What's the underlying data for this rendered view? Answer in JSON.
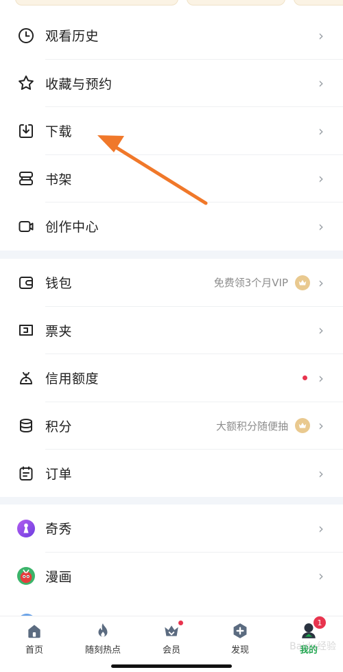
{
  "colors": {
    "accent_green": "#1aa34a",
    "arrow_orange": "#f0782a",
    "badge_red": "#e8344e",
    "crown_gold": "#e9c98f",
    "chevron_gray": "#9aa0a6"
  },
  "section1": {
    "items": [
      {
        "label": "观看历史",
        "icon": "clock-icon"
      },
      {
        "label": "收藏与预约",
        "icon": "star-icon"
      },
      {
        "label": "下载",
        "icon": "download-icon"
      },
      {
        "label": "书架",
        "icon": "bookshelf-icon"
      },
      {
        "label": "创作中心",
        "icon": "video-camera-icon"
      }
    ]
  },
  "section2": {
    "items": [
      {
        "label": "钱包",
        "icon": "wallet-icon",
        "extra": "免费领3个月VIP",
        "extra_icon": "crown-icon"
      },
      {
        "label": "票夹",
        "icon": "ticket-icon"
      },
      {
        "label": "信用额度",
        "icon": "credit-icon",
        "extra_icon": "red-dot"
      },
      {
        "label": "积分",
        "icon": "coins-icon",
        "extra": "大额积分随便抽",
        "extra_icon": "crown-icon"
      },
      {
        "label": "订单",
        "icon": "order-icon"
      }
    ]
  },
  "section3": {
    "items": [
      {
        "label": "奇秀",
        "icon": "qixiu-app-icon"
      },
      {
        "label": "漫画",
        "icon": "comic-app-icon"
      }
    ]
  },
  "chevron": "›",
  "tabbar": {
    "tabs": [
      {
        "label": "首页",
        "icon": "home-icon"
      },
      {
        "label": "随刻热点",
        "icon": "flame-icon"
      },
      {
        "label": "会员",
        "icon": "vip-crown-icon",
        "badge": "dot"
      },
      {
        "label": "发现",
        "icon": "discover-icon"
      },
      {
        "label": "我的",
        "icon": "profile-icon",
        "badge": "1",
        "active": true
      }
    ]
  },
  "watermark": "Baidu经验"
}
